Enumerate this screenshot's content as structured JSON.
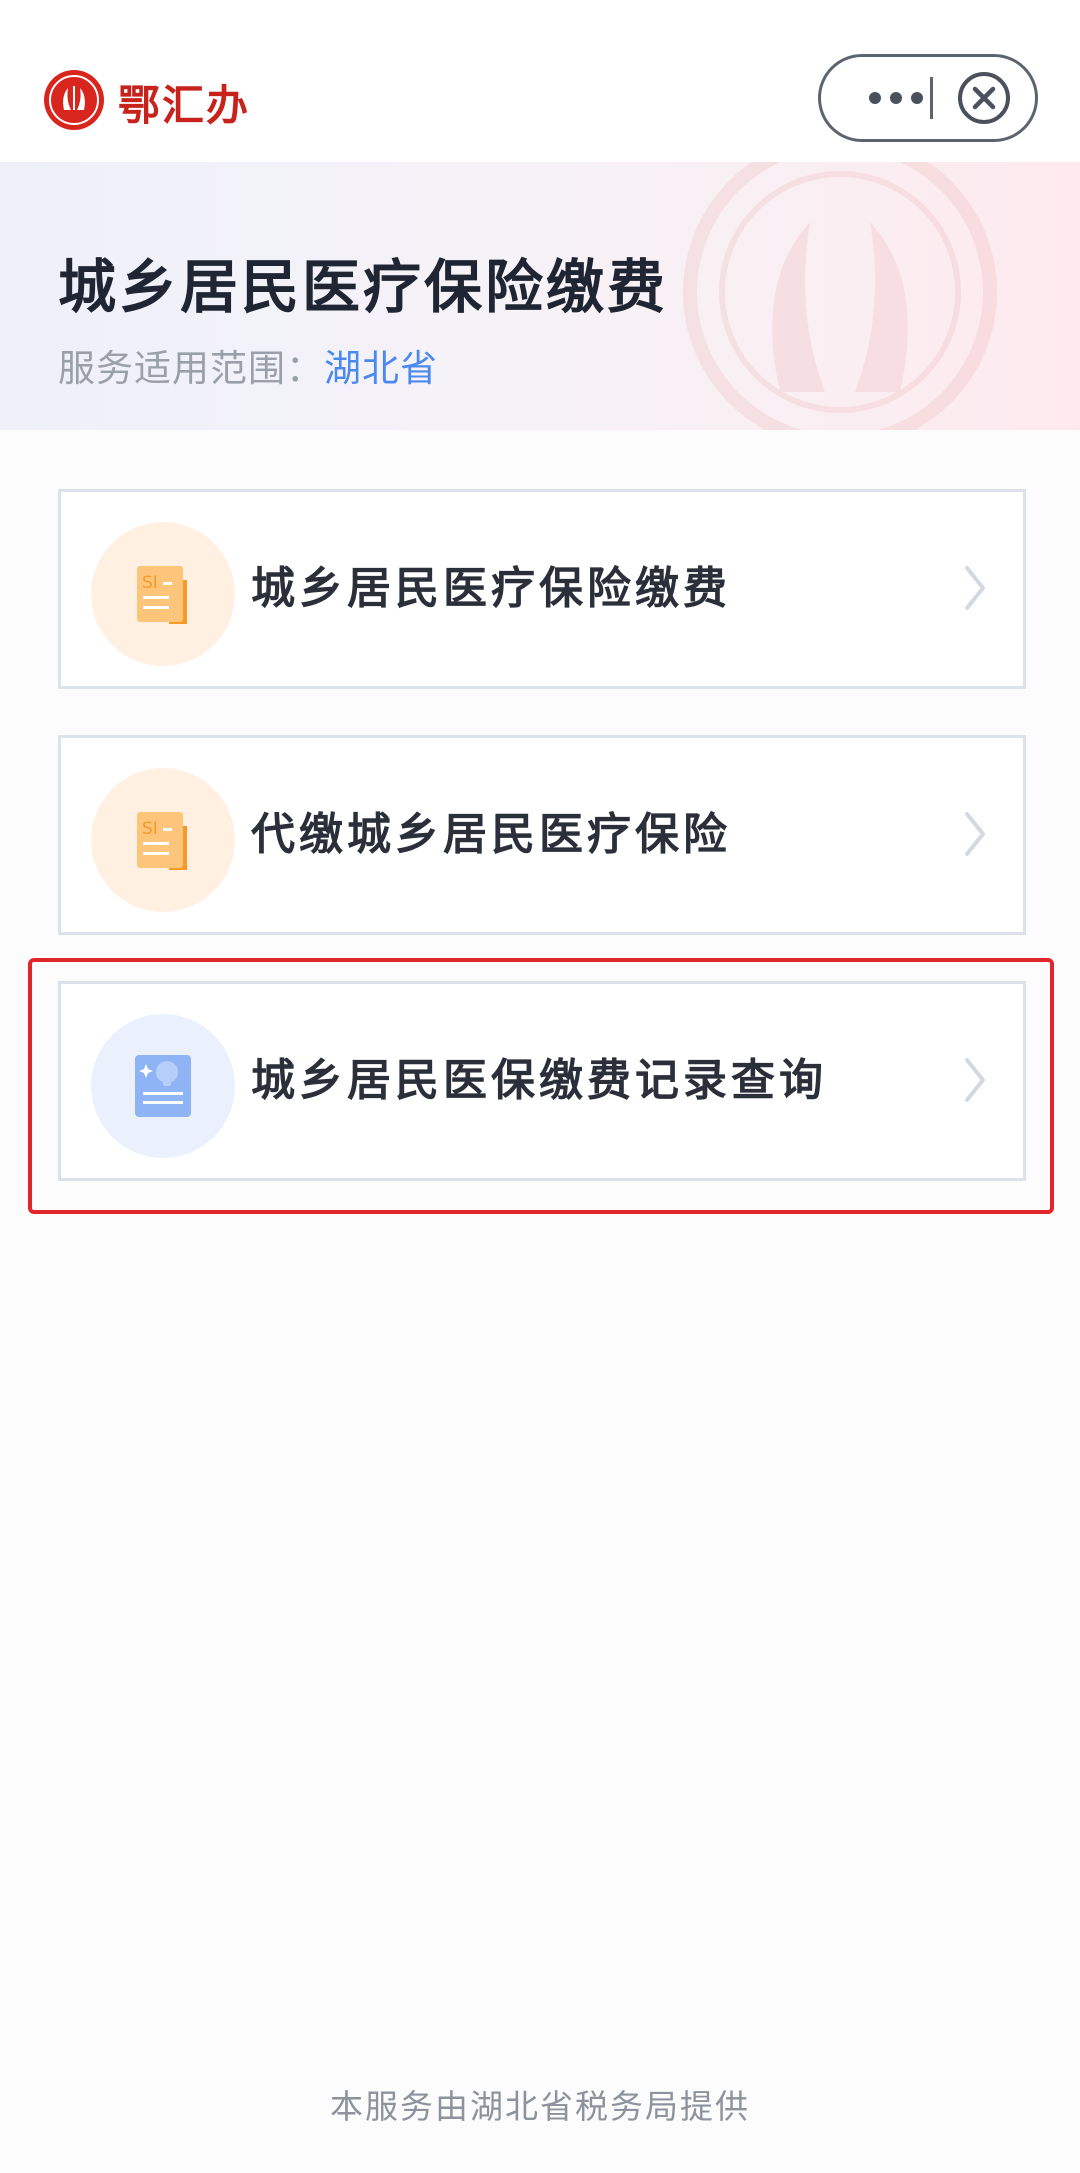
{
  "app": {
    "brand_name": "鄂汇办",
    "brand_color": "#c7231c"
  },
  "capsule": {
    "more_icon": "more-dots-icon",
    "close_icon": "close-circle-icon"
  },
  "header": {
    "title": "城乡居民医疗保险缴费",
    "scope_label": "服务适用范围：",
    "scope_value": "湖北省"
  },
  "services": [
    {
      "label": "城乡居民医疗保险缴费",
      "icon": "si-document-icon",
      "highlighted": false
    },
    {
      "label": "代缴城乡居民医疗保险",
      "icon": "si-document-icon",
      "highlighted": false
    },
    {
      "label": "城乡居民医保缴费记录查询",
      "icon": "record-query-icon",
      "highlighted": true
    }
  ],
  "footer": {
    "text": "本服务由湖北省税务局提供"
  },
  "colors": {
    "accent_blue": "#4a8af0",
    "highlight_red": "#e0262b",
    "icon_orange": "#f7a53d"
  }
}
